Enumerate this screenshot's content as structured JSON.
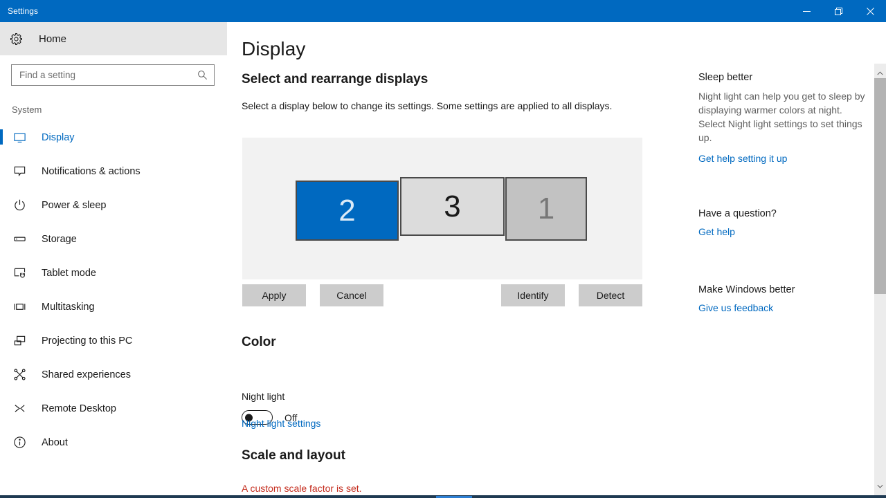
{
  "window": {
    "title": "Settings",
    "accent_color": "#0069c0",
    "controls": [
      {
        "name": "minimize",
        "glyph": "minimize-icon"
      },
      {
        "name": "restore",
        "glyph": "restore-icon"
      },
      {
        "name": "close",
        "glyph": "close-icon"
      }
    ]
  },
  "sidebar": {
    "home_label": "Home",
    "home_icon": "gear-icon",
    "search": {
      "placeholder": "Find a setting",
      "value": "",
      "icon": "search-icon"
    },
    "section_title": "System",
    "items": [
      {
        "label": "Display",
        "icon": "monitor-icon",
        "active": true
      },
      {
        "label": "Notifications & actions",
        "icon": "speech-bubble-icon",
        "active": false
      },
      {
        "label": "Power & sleep",
        "icon": "power-icon",
        "active": false
      },
      {
        "label": "Storage",
        "icon": "drive-icon",
        "active": false
      },
      {
        "label": "Tablet mode",
        "icon": "tablet-hand-icon",
        "active": false
      },
      {
        "label": "Multitasking",
        "icon": "multitask-icon",
        "active": false
      },
      {
        "label": "Projecting to this PC",
        "icon": "project-screen-icon",
        "active": false
      },
      {
        "label": "Shared experiences",
        "icon": "share-nodes-icon",
        "active": false
      },
      {
        "label": "Remote Desktop",
        "icon": "remote-desktop-icon",
        "active": false
      },
      {
        "label": "About",
        "icon": "info-icon",
        "active": false
      }
    ]
  },
  "main": {
    "page_title": "Display",
    "arrange": {
      "heading": "Select and rearrange displays",
      "description": "Select a display below to change its settings. Some settings are applied to all displays.",
      "monitors": [
        {
          "number": "2",
          "state": "selected",
          "fill": "#0069c0",
          "text_color": "#dbeaf7"
        },
        {
          "number": "3",
          "state": "normal",
          "fill": "#dcdcdc",
          "text_color": "#1a1a1a"
        },
        {
          "number": "1",
          "state": "dimmed",
          "fill": "#c2c2c2",
          "text_color": "#777777"
        }
      ],
      "buttons": {
        "apply": "Apply",
        "cancel": "Cancel",
        "identify": "Identify",
        "detect": "Detect"
      }
    },
    "color": {
      "heading": "Color",
      "night_light_label": "Night light",
      "night_light_state": "Off",
      "night_light_on": false,
      "settings_link": "Night light settings"
    },
    "scale": {
      "heading": "Scale and layout",
      "warning": "A custom scale factor is set.",
      "warning_color": "#c42b1c"
    }
  },
  "help": {
    "sections": [
      {
        "title": "Sleep better",
        "body": "Night light can help you get to sleep by displaying warmer colors at night. Select Night light settings to set things up.",
        "link": "Get help setting it up"
      },
      {
        "title": "Have a question?",
        "body": "",
        "link": "Get help"
      },
      {
        "title": "Make Windows better",
        "body": "",
        "link": "Give us feedback"
      }
    ],
    "link_color": "#0069c0"
  },
  "scrollbar": {
    "up_icon": "chevron-up-icon",
    "down_icon": "chevron-down-icon"
  }
}
